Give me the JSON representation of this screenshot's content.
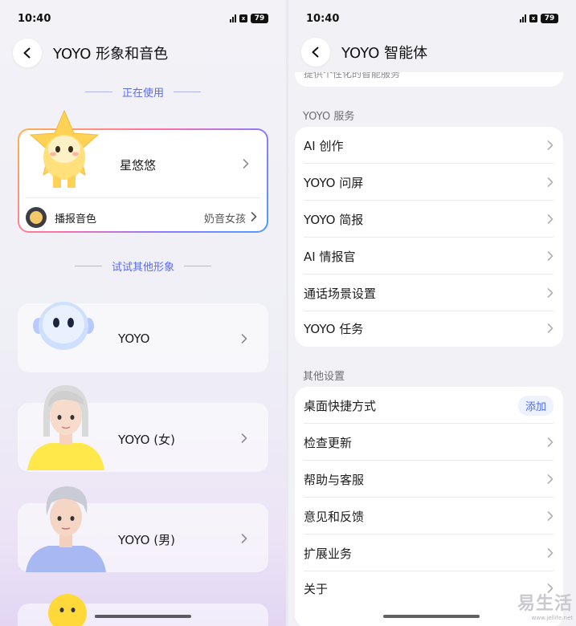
{
  "left": {
    "status": {
      "time": "10:40",
      "battery": "79"
    },
    "title": "YOYO 形象和音色",
    "current_section": "正在使用",
    "current": {
      "name": "星悠悠",
      "voice_label": "播报音色",
      "voice_value": "奶音女孩"
    },
    "others_section": "试试其他形象",
    "others": [
      {
        "name": "YOYO"
      },
      {
        "name": "YOYO (女)"
      },
      {
        "name": "YOYO (男)"
      }
    ]
  },
  "right": {
    "status": {
      "time": "10:40",
      "battery": "79"
    },
    "title": "YOYO 智能体",
    "cut_text": "提供个性化的智能服务",
    "services_label": "YOYO 服务",
    "services": [
      {
        "label": "AI 创作"
      },
      {
        "label": "YOYO 问屏"
      },
      {
        "label": "YOYO 简报"
      },
      {
        "label": "AI 情报官"
      },
      {
        "label": "通话场景设置"
      },
      {
        "label": "YOYO 任务"
      }
    ],
    "other_label": "其他设置",
    "other": [
      {
        "label": "桌面快捷方式",
        "action": "添加"
      },
      {
        "label": "检查更新"
      },
      {
        "label": "帮助与客服"
      },
      {
        "label": "意见和反馈"
      },
      {
        "label": "扩展业务"
      },
      {
        "label": "关于"
      }
    ]
  },
  "watermark": {
    "main": "易生活",
    "sub": "www.jellife.net"
  },
  "colors": {
    "accent": "#5b6cf0",
    "link": "#4a6cf7"
  }
}
